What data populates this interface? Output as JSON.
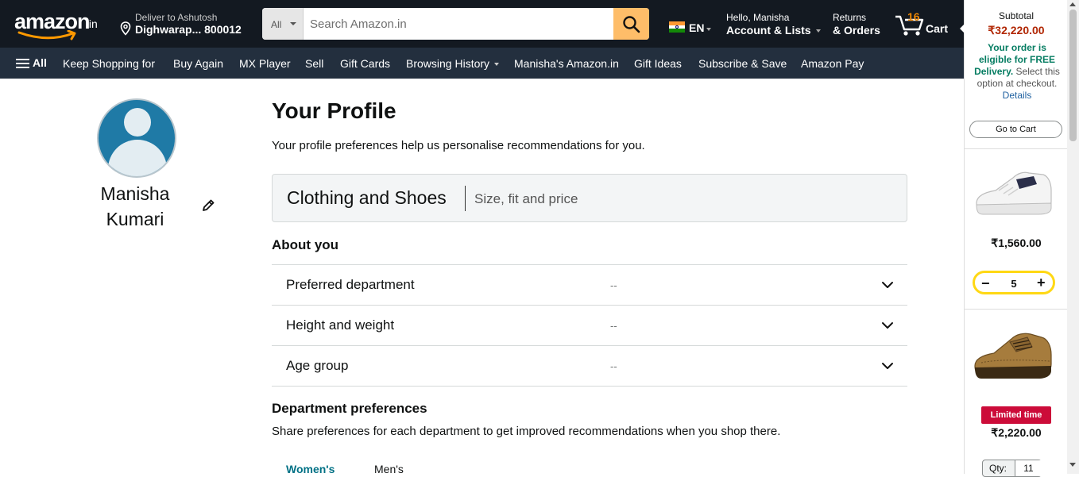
{
  "header": {
    "logo_text": "amazon",
    "logo_tld": ".in",
    "deliver_line1": "Deliver to Ashutosh",
    "deliver_line2": "Dighwarap... 800012",
    "search_category": "All",
    "search_placeholder": "Search Amazon.in",
    "language": "EN",
    "account_line1": "Hello, Manisha",
    "account_line2": "Account & Lists",
    "orders_line1": "Returns",
    "orders_line2": "& Orders",
    "cart_count": "16",
    "cart_label": "Cart"
  },
  "subnav": {
    "all_label": "All",
    "items": [
      "Keep Shopping for",
      "Buy Again",
      "MX Player",
      "Sell",
      "Gift Cards",
      "Browsing History",
      "Manisha's Amazon.in",
      "Gift Ideas",
      "Subscribe & Save",
      "Amazon Pay"
    ]
  },
  "profile": {
    "first_name": "Manisha",
    "last_name": "Kumari"
  },
  "main": {
    "title": "Your Profile",
    "subtitle": "Your profile preferences help us personalise recommendations for you.",
    "tab_title": "Clothing and Shoes",
    "tab_subtitle": "Size, fit and price",
    "about_heading": "About you",
    "rows": [
      {
        "label": "Preferred department",
        "value": "--"
      },
      {
        "label": "Height and weight",
        "value": "--"
      },
      {
        "label": "Age group",
        "value": "--"
      }
    ],
    "dept_heading": "Department preferences",
    "dept_subtitle": "Share preferences for each department to get improved recommendations when you shop there.",
    "dept_tabs": [
      "Women's",
      "Men's"
    ]
  },
  "cart_panel": {
    "subtotal_label": "Subtotal",
    "subtotal_value": "₹32,220.00",
    "free_bold": "Your order is eligible for FREE Delivery.",
    "free_rest": " Select this option at checkout.",
    "details_link": "Details",
    "go_to_cart": "Go to Cart",
    "items": [
      {
        "price": "₹1,560.00",
        "quantity": "5"
      },
      {
        "badge": "Limited time",
        "price": "₹2,220.00",
        "qty_label": "Qty:",
        "quantity": "11"
      }
    ]
  },
  "colors": {
    "nav_bg": "#131921",
    "subnav_bg": "#232f3e",
    "search_button": "#febd69",
    "price_red": "#b12704",
    "free_green": "#067d62",
    "link_teal": "#007185",
    "stepper_yellow": "#ffd814",
    "badge_red": "#cc0c39"
  }
}
